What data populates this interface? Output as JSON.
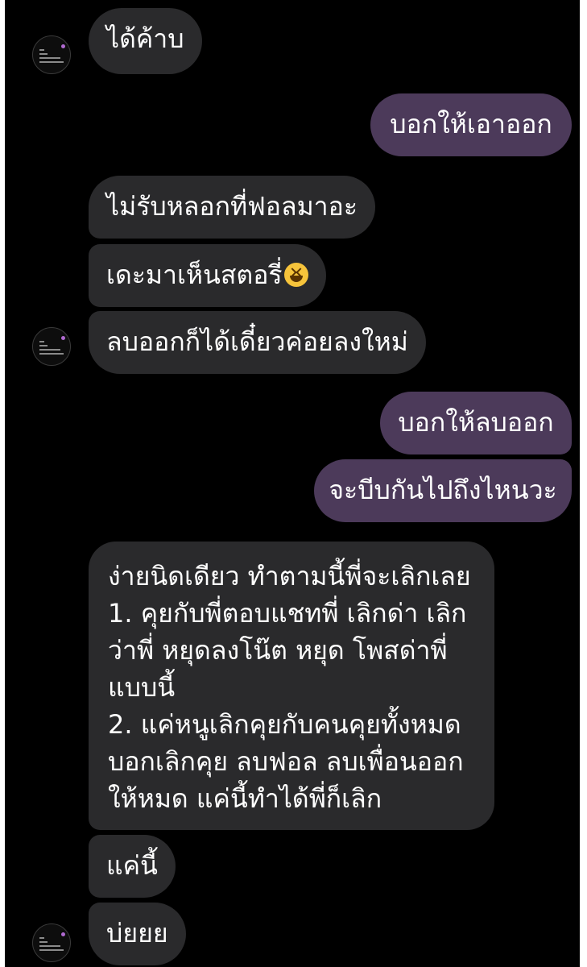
{
  "messages": [
    {
      "text": "ได้ค้าบ"
    },
    {
      "text": "บอกให้เอาออก"
    },
    {
      "text": "ไม่รับหลอกที่ฟอลมาอะ"
    },
    {
      "text": "เดะมาเห็นสตอรี่"
    },
    {
      "text": "ลบออกก็ได้เดี๋ยวค่อยลงใหม่"
    },
    {
      "text": "บอกให้ลบออก"
    },
    {
      "text": "จะบีบกันไปถึงไหนวะ"
    },
    {
      "lines": [
        "ง่ายนิดเดียว ทำตามนี้พี่จะเลิกเลย",
        "1. คุยกับพี่ตอบแชทพี่  เลิกด่า เลิก",
        "ว่าพี่ หยุดลงโน๊ต หยุด โพสด่าพี่",
        "แบบนี้",
        "2. แค่หนูเลิกคุยกับคนคุยทั้งหมด",
        "บอกเลิกคุย ลบฟอล ลบเพื่อนออก",
        "ให้หมด แค่นี้ทำได้พี่ก็เลิก"
      ]
    },
    {
      "text": "แค่นี้"
    },
    {
      "text": "บ่ยยย"
    }
  ],
  "emoji_icon": "grinning-squinting-face",
  "colors": {
    "background": "#000000",
    "received_bubble": "#2a2a2c",
    "sent_bubble": "#4c3a5a",
    "text": "#ffffff"
  }
}
